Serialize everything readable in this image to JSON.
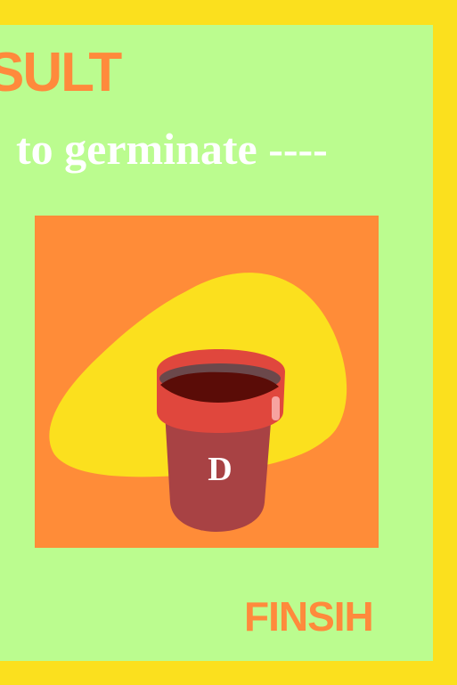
{
  "screen": {
    "title": "SULT",
    "subtitle": "to germinate ----",
    "finish_label": "FINSIH"
  },
  "pot": {
    "label": "D"
  },
  "colors": {
    "border": "#fbe01e",
    "background": "#bbfc8f",
    "accent_orange": "#ff8a3c",
    "card": "#ff8c38",
    "blob": "#fbe01e",
    "pot_body": "#a84244",
    "pot_rim": "#e0473d",
    "soil": "#5a0c07",
    "text_white": "#ffffff"
  },
  "icons": {
    "pot": "flower-pot-icon",
    "blob": "seed-blob-shape"
  }
}
